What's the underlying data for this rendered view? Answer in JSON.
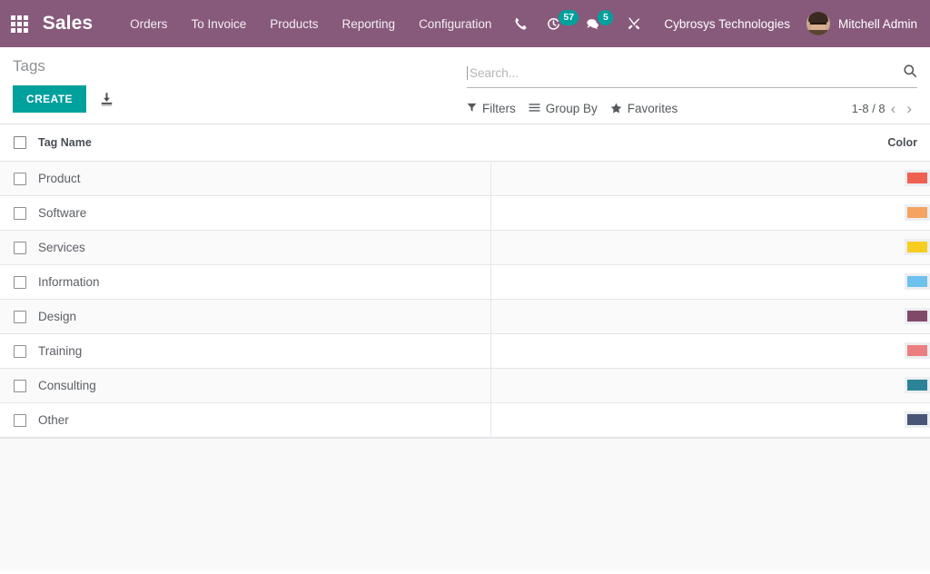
{
  "navbar": {
    "apps_icon": "apps-grid-icon",
    "brand": "Sales",
    "menu": [
      {
        "label": "Orders"
      },
      {
        "label": "To Invoice"
      },
      {
        "label": "Products"
      },
      {
        "label": "Reporting"
      },
      {
        "label": "Configuration"
      }
    ],
    "icons": [
      {
        "name": "phone-icon",
        "badge": null
      },
      {
        "name": "activity-clock-icon",
        "badge": "57"
      },
      {
        "name": "messages-chat-icon",
        "badge": "5"
      },
      {
        "name": "debug-tools-icon",
        "badge": null
      }
    ],
    "company": "Cybrosys Technologies",
    "user": "Mitchell Admin",
    "brand_color": "#875A7B",
    "badge_color": "#00A09D"
  },
  "control_panel": {
    "breadcrumb": "Tags",
    "create_label": "CREATE",
    "create_color": "#00A09D",
    "import_icon": "import-download-icon",
    "search": {
      "placeholder": "Search...",
      "value": "",
      "icon": "search-icon"
    },
    "filters": [
      {
        "label": "Filters",
        "icon": "filter-funnel-icon",
        "glyph": "▼"
      },
      {
        "label": "Group By",
        "icon": "group-by-lines-icon",
        "glyph": "≡"
      },
      {
        "label": "Favorites",
        "icon": "favorites-star-icon",
        "glyph": "★"
      }
    ],
    "pager": {
      "count": "1-8 / 8",
      "prev_icon": "chevron-left-icon",
      "prev_glyph": "‹",
      "next_icon": "chevron-right-icon",
      "next_glyph": "›"
    }
  },
  "list": {
    "columns": {
      "name": "Tag Name",
      "color": "Color"
    },
    "rows": [
      {
        "name": "Product",
        "color": "#F06050"
      },
      {
        "name": "Software",
        "color": "#F4A460"
      },
      {
        "name": "Services",
        "color": "#F7CD1F"
      },
      {
        "name": "Information",
        "color": "#6CC1ED"
      },
      {
        "name": "Design",
        "color": "#814968"
      },
      {
        "name": "Training",
        "color": "#EB7E7F"
      },
      {
        "name": "Consulting",
        "color": "#2C8397"
      },
      {
        "name": "Other",
        "color": "#475577"
      }
    ]
  }
}
